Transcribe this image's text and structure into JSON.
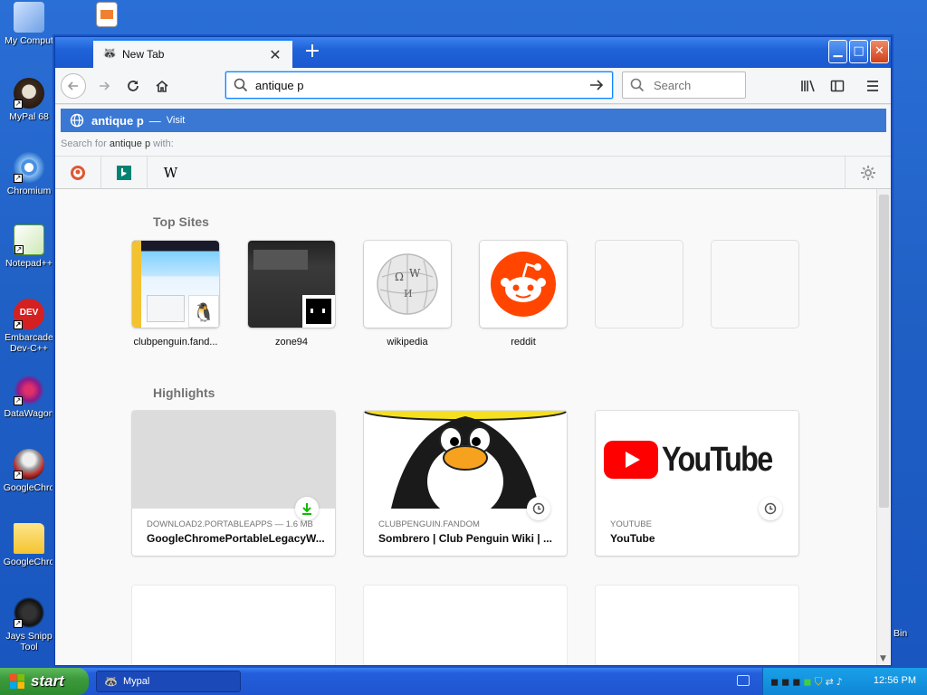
{
  "desktop": {
    "icons": [
      {
        "label": "My Comput"
      },
      {
        "label": "MyPal 68"
      },
      {
        "label": "Chromium"
      },
      {
        "label": "Notepad++"
      },
      {
        "label": "Embarcade Dev-C++"
      },
      {
        "label": "DataWagon"
      },
      {
        "label": "GoogleChro"
      },
      {
        "label": "GoogleChro"
      },
      {
        "label": "Jays Snipp Tool"
      }
    ],
    "recycle_label": "Bin"
  },
  "browser": {
    "tab": {
      "label": "New Tab"
    },
    "urlbar": {
      "value": "antique p"
    },
    "searchbar": {
      "placeholder": "Search"
    },
    "suggestion": {
      "query": "antique p",
      "separator": "—",
      "action": "Visit"
    },
    "search_for": {
      "prefix": "Search for",
      "query": "antique p",
      "suffix": "with:"
    }
  },
  "newtab": {
    "top_sites_heading": "Top Sites",
    "top_sites": [
      {
        "name": "clubpenguin.fand..."
      },
      {
        "name": "zone94"
      },
      {
        "name": "wikipedia"
      },
      {
        "name": "reddit"
      }
    ],
    "highlights_heading": "Highlights",
    "highlights": [
      {
        "source": "DOWNLOAD2.PORTABLEAPPS — 1.6 MB",
        "title": "GoogleChromePortableLegacyW..."
      },
      {
        "source": "CLUBPENGUIN.FANDOM",
        "title": "Sombrero | Club Penguin Wiki | ..."
      },
      {
        "source": "YOUTUBE",
        "title": "YouTube"
      }
    ],
    "youtube_logo_text": "YouTube"
  },
  "taskbar": {
    "start_label": "start",
    "item_label": "Mypal",
    "clock": "12:56 PM"
  },
  "colors": {
    "accent": "#0a84ff",
    "suggestion_bg": "#3a78d4",
    "reddit": "#ff4500",
    "youtube": "#ff0000"
  }
}
